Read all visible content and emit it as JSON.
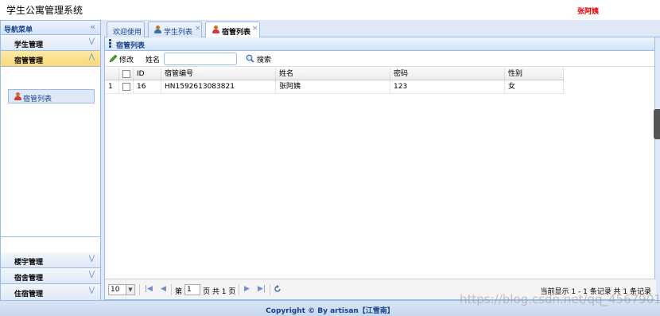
{
  "app": {
    "title": "学生公寓管理系统",
    "user": "张阿姨",
    "footer": "Copyright © By artisan【江雪南】",
    "watermark": "https://blog.csdn.net/qq_45679015"
  },
  "sidebar": {
    "title": "导航菜单",
    "collapse_glyph": "«",
    "sections": [
      {
        "label": "学生管理",
        "state": "collapsed"
      },
      {
        "label": "宿管管理",
        "state": "expanded",
        "items": [
          {
            "label": "宿管列表",
            "icon": "user-icon"
          }
        ]
      },
      {
        "label": "楼宇管理",
        "state": "collapsed"
      },
      {
        "label": "宿舍管理",
        "state": "collapsed"
      },
      {
        "label": "住宿管理",
        "state": "collapsed"
      }
    ]
  },
  "tabs": [
    {
      "label": "欢迎使用",
      "closable": false,
      "active": false
    },
    {
      "label": "学生列表",
      "closable": true,
      "active": false,
      "icon": "user-icon"
    },
    {
      "label": "宿管列表",
      "closable": true,
      "active": true,
      "icon": "user-icon"
    }
  ],
  "panel": {
    "title": "宿管列表"
  },
  "toolbar": {
    "edit_label": "修改",
    "name_label": "姓名",
    "name_value": "",
    "search_label": "搜索"
  },
  "grid": {
    "columns": [
      "ID",
      "宿管编号",
      "姓名",
      "密码",
      "性别"
    ],
    "rows": [
      {
        "num": "1",
        "cells": [
          "16",
          "HN1592613083821",
          "张阿姨",
          "123",
          "女"
        ]
      }
    ]
  },
  "pager": {
    "page_size": "10",
    "page_prefix": "第",
    "page_value": "1",
    "page_suffix": "页 共 1 页",
    "info": "当前显示 1 - 1 条记录 共 1 条记录"
  },
  "colors": {
    "accent": "#15428b",
    "border": "#99bbe8",
    "active_section": "#fbd876",
    "user_name": "#e00000"
  }
}
